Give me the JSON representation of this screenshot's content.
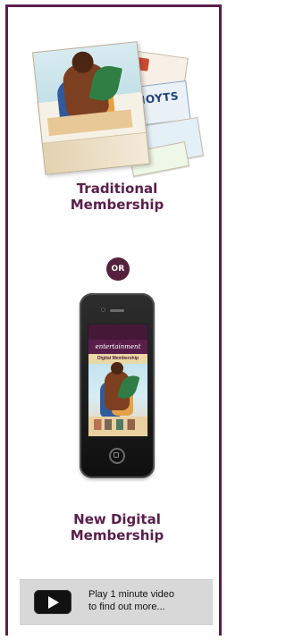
{
  "panel": {
    "traditional_label": "Traditional\nMembership",
    "or_label": "OR",
    "digital_label": "New Digital\nMembership"
  },
  "book": {
    "hoyts_label": "HOYTS"
  },
  "phone": {
    "brand_text": "entertainment",
    "subheader_text": "Digital Membership"
  },
  "video": {
    "text": "Play 1 minute video\nto find out more...",
    "icon": "play-icon"
  },
  "colors": {
    "brand_purple": "#5a1e4b",
    "banner_gray": "#d8d8d8",
    "text_dark": "#111111",
    "white": "#ffffff"
  }
}
